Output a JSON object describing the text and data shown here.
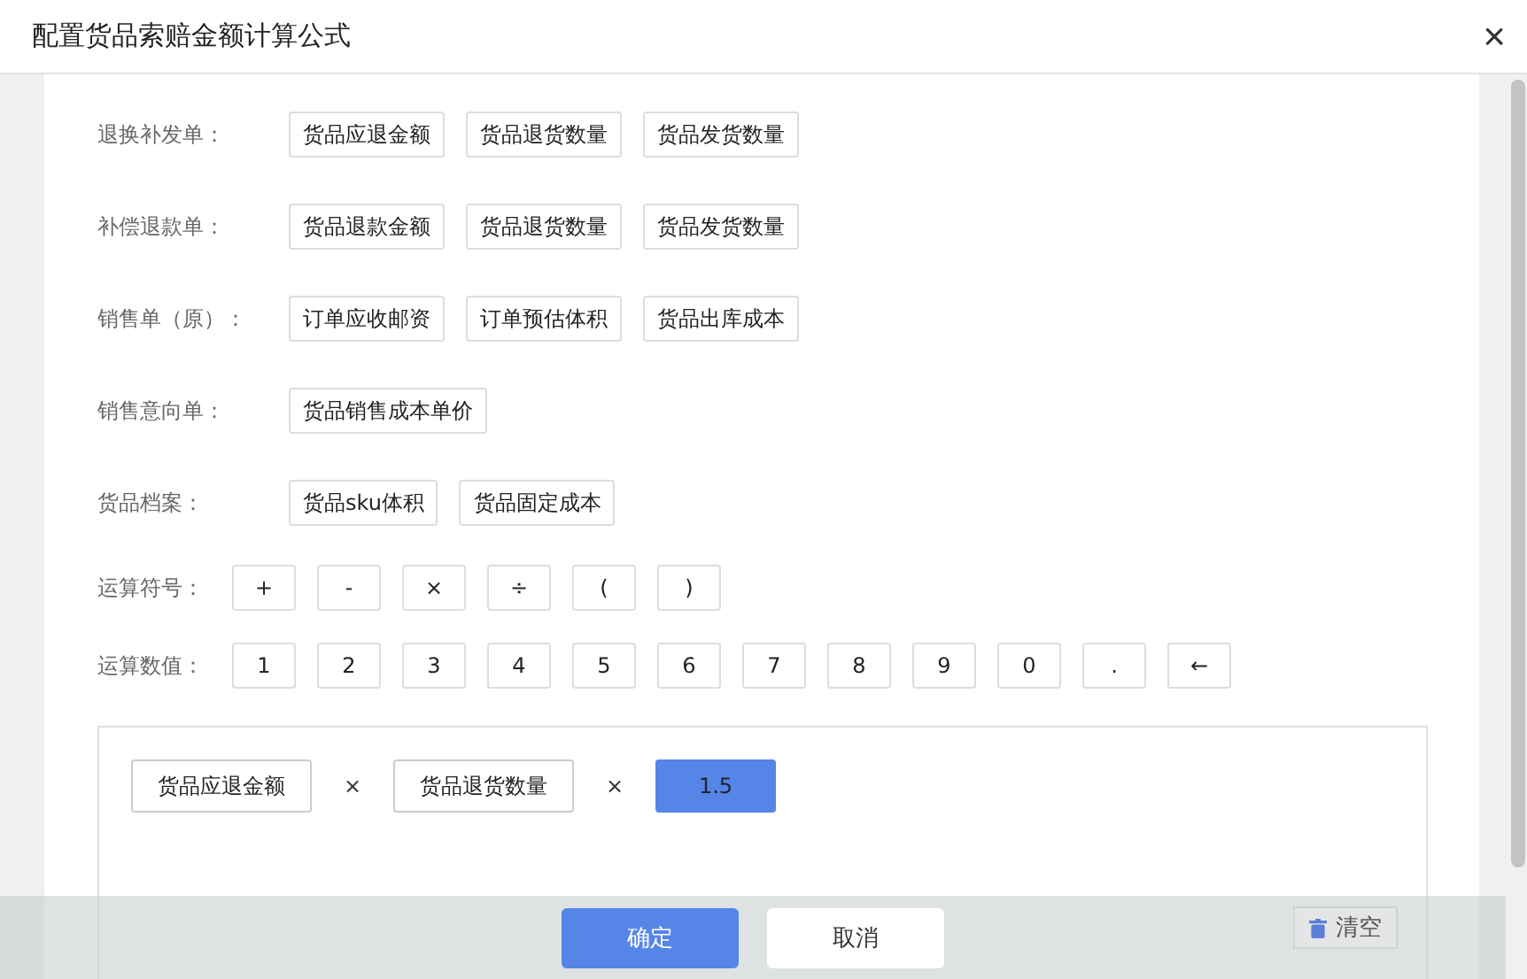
{
  "dialog": {
    "title": "配置货品索赔金额计算公式",
    "close": "×"
  },
  "groups": [
    {
      "label": "退换补发单：",
      "fields": [
        "货品应退金额",
        "货品退货数量",
        "货品发货数量"
      ]
    },
    {
      "label": "补偿退款单：",
      "fields": [
        "货品退款金额",
        "货品退货数量",
        "货品发货数量"
      ]
    },
    {
      "label": "销售单（原）：",
      "fields": [
        "订单应收邮资",
        "订单预估体积",
        "货品出库成本"
      ]
    },
    {
      "label": "销售意向单：",
      "fields": [
        "货品销售成本单价"
      ]
    },
    {
      "label": "货品档案：",
      "fields": [
        "货品sku体积",
        "货品固定成本"
      ]
    }
  ],
  "operators": {
    "label": "运算符号：",
    "keys": [
      "+",
      "-",
      "×",
      "÷",
      "(",
      ")"
    ]
  },
  "numbers": {
    "label": "运算数值：",
    "keys": [
      "1",
      "2",
      "3",
      "4",
      "5",
      "6",
      "7",
      "8",
      "9",
      "0",
      ".",
      "←"
    ]
  },
  "formula": [
    {
      "kind": "field",
      "text": "货品应退金额"
    },
    {
      "kind": "operator",
      "text": "×"
    },
    {
      "kind": "field",
      "text": "货品退货数量"
    },
    {
      "kind": "operator",
      "text": "×"
    },
    {
      "kind": "number",
      "text": "1.5"
    }
  ],
  "footer": {
    "confirm": "确定",
    "cancel": "取消",
    "clear": "清空"
  }
}
